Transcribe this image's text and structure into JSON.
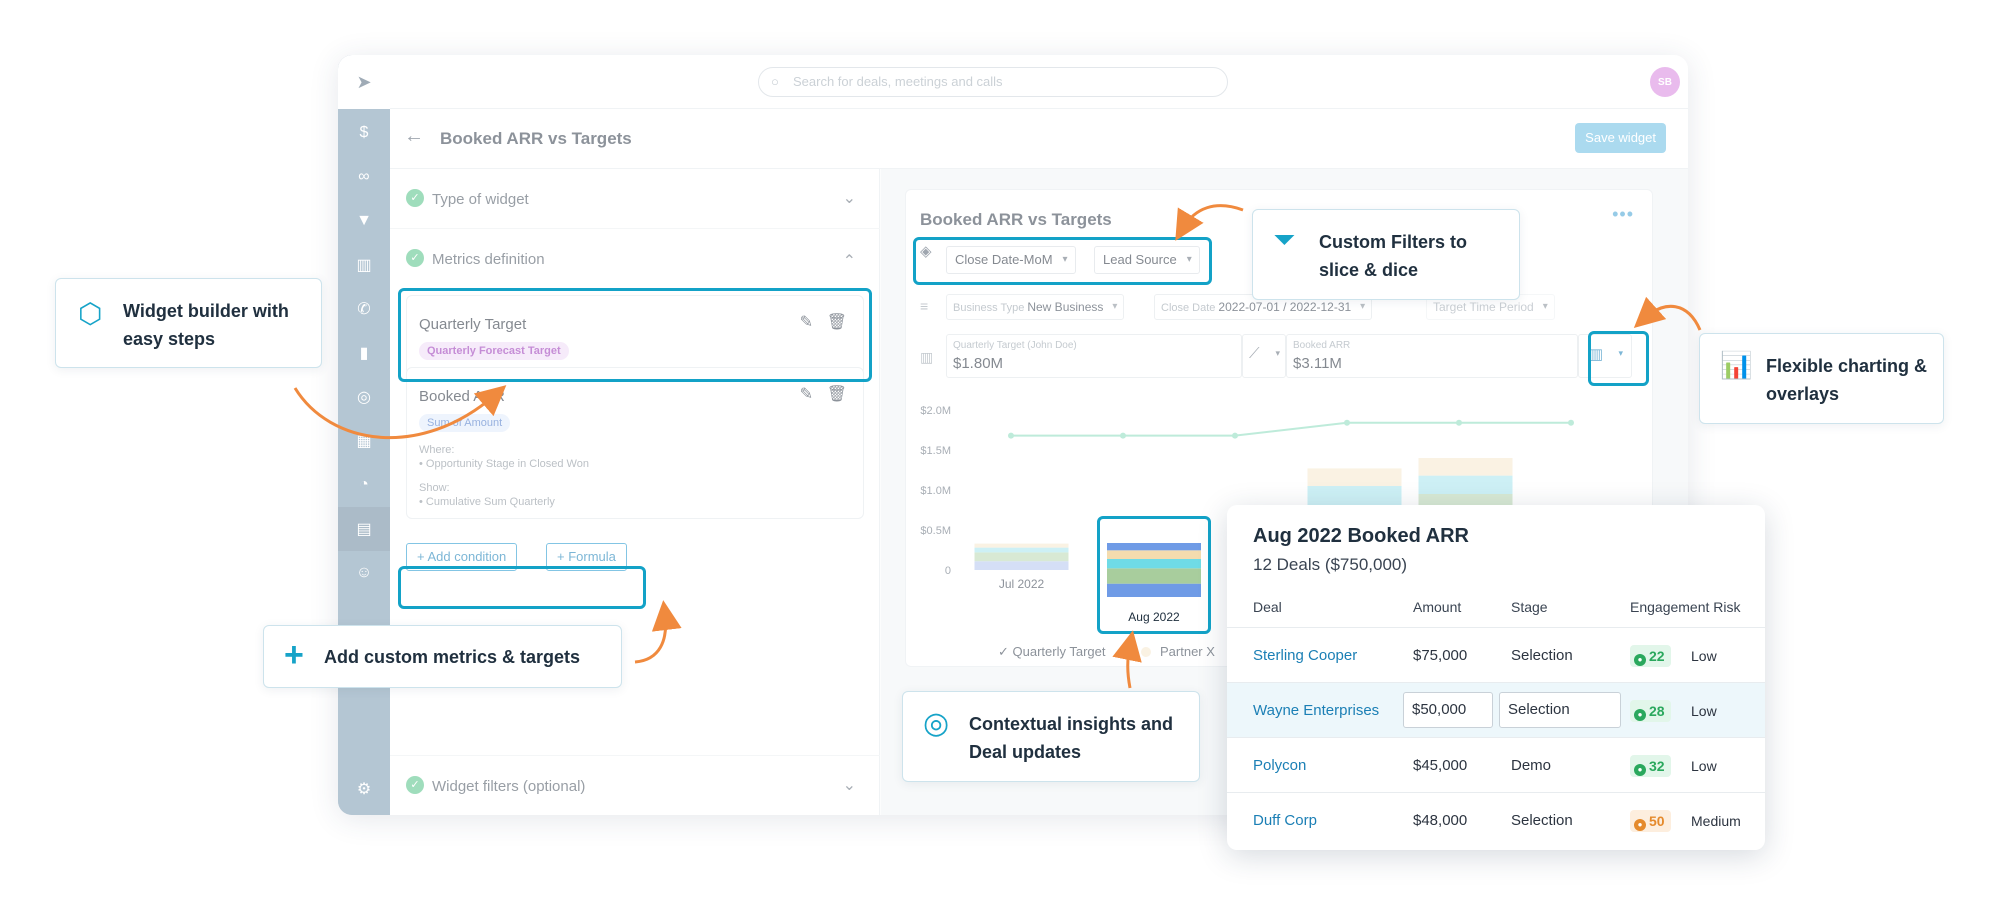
{
  "search": {
    "placeholder": "Search for deals, meetings and calls"
  },
  "user": {
    "initials": "SB"
  },
  "header": {
    "title": "Booked ARR vs Targets",
    "save_label": "Save widget"
  },
  "sections": {
    "type_of_widget": "Type of widget",
    "metrics_definition": "Metrics definition",
    "widget_filters": "Widget filters (optional)"
  },
  "metrics": [
    {
      "title": "Quarterly Target",
      "tag": "Quarterly Forecast Target"
    },
    {
      "title": "Booked ARR",
      "tag": "Sum of Amount",
      "where_label": "Where:",
      "where_value": "Opportunity Stage in Closed Won",
      "show_label": "Show:",
      "show_value": "Cumulative Sum Quarterly"
    }
  ],
  "actions": {
    "add_condition": "+ Add condition",
    "formula": "+ Formula"
  },
  "chart_card": {
    "title": "Booked ARR vs Targets",
    "group_by": [
      "Close Date-MoM",
      "Lead Source"
    ],
    "filters": [
      {
        "key": "Business Type",
        "value": "New Business"
      },
      {
        "key": "Close Date",
        "value": "2022-07-01 / 2022-12-31"
      },
      {
        "key": "",
        "value": "Target Time Period"
      }
    ],
    "metric_boxes": [
      {
        "label": "Quarterly Target (John Doe)",
        "value": "$1.80M"
      },
      {
        "label": "Booked ARR",
        "value": "$3.11M"
      }
    ]
  },
  "chart_data": {
    "type": "bar",
    "categories": [
      "Jul 2022",
      "Aug 2022",
      "",
      "",
      ""
    ],
    "ylim": [
      0,
      2000000
    ],
    "ytick_labels": [
      "$2.0M",
      "$1.5M",
      "$1.0M",
      "$0.5M",
      "0"
    ],
    "yticks": [
      2000000,
      1500000,
      1000000,
      500000,
      0
    ],
    "stacks": [
      [
        110000,
        110000,
        60000,
        50000
      ],
      [
        200000,
        230000,
        140000,
        130000,
        110000
      ],
      [
        0,
        0,
        0,
        0,
        0
      ],
      [
        500000,
        300000,
        250000,
        220000
      ],
      [
        520000,
        430000,
        230000,
        220000
      ]
    ],
    "stack_colors": [
      "#b7c9ef",
      "#bcd9b6",
      "#a9e6ee",
      "#f6e8cf"
    ],
    "highlight_stack_colors": [
      "#6f9be6",
      "#a8cd9d",
      "#6fdbe6",
      "#f4dcae"
    ],
    "line": {
      "name": "Quarterly Target",
      "x": [
        0,
        1,
        2,
        3,
        4,
        5
      ],
      "values": [
        1680000,
        1680000,
        1680000,
        1840000,
        1840000,
        1840000
      ],
      "color": "#8fdcbf"
    },
    "legend": [
      "Quarterly Target",
      "Partner X"
    ],
    "grid": false
  },
  "callouts": {
    "widget_builder": "Widget builder with easy steps",
    "custom_metrics": "Add custom metrics & targets",
    "custom_filters": "Custom Filters to slice & dice",
    "flexible_charting": "Flexible charting & overlays",
    "contextual": "Contextual insights and Deal updates"
  },
  "popup": {
    "title": "Aug 2022 Booked ARR",
    "subtitle": "12 Deals ($750,000)",
    "columns": [
      "Deal",
      "Amount",
      "Stage",
      "Engagement Risk"
    ],
    "rows": [
      {
        "deal": "Sterling Cooper",
        "amount": "$75,000",
        "stage": "Selection",
        "score": "22",
        "risk": "Low"
      },
      {
        "deal": "Wayne Enterprises",
        "amount": "$50,000",
        "stage": "Selection",
        "score": "28",
        "risk": "Low"
      },
      {
        "deal": "Polycon",
        "amount": "$45,000",
        "stage": "Demo",
        "score": "32",
        "risk": "Low"
      },
      {
        "deal": "Duff Corp",
        "amount": "$48,000",
        "stage": "Selection",
        "score": "50",
        "risk": "Medium"
      }
    ]
  },
  "colors": {
    "accent": "#13a2c7",
    "arrow": "#f08a3e",
    "rail": "#7f9db3"
  }
}
